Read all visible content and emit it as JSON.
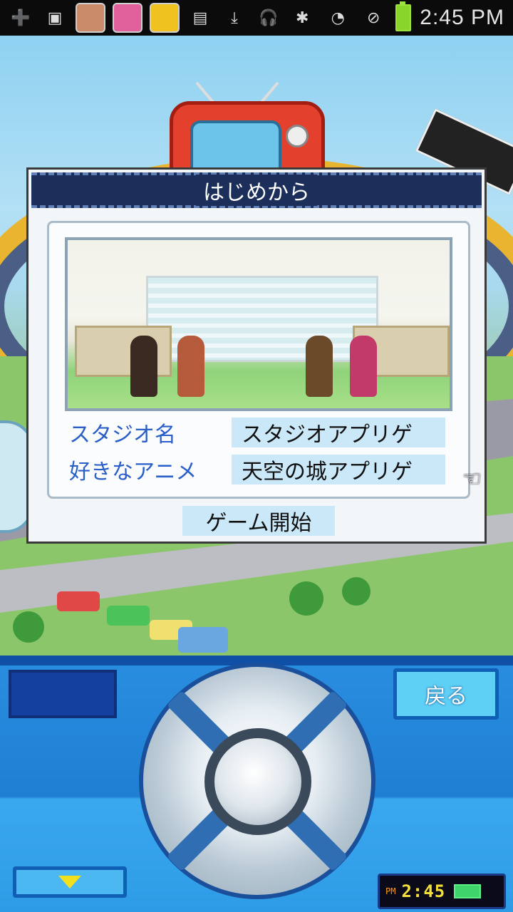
{
  "status_bar": {
    "time": "2:45 PM",
    "left_icons": [
      "plus-icon",
      "image-icon",
      "app-icon-1",
      "app-icon-2",
      "app-icon-3",
      "sd-card-icon",
      "download-icon",
      "headphones-icon"
    ],
    "right_icons": [
      "bluetooth-icon",
      "wifi-icon",
      "no-signal-icon",
      "battery-icon"
    ]
  },
  "dialog": {
    "title": "はじめから",
    "studio_label": "スタジオ名",
    "studio_value": "スタジオアプリゲ",
    "anime_label": "好きなアニメ",
    "anime_value": "天空の城アプリゲ",
    "start_label": "ゲーム開始"
  },
  "panel": {
    "back_label": "戻る",
    "clock_ampm": "PM",
    "clock_time": "2:45"
  },
  "colors": {
    "dialog_header": "#1b2f5a",
    "label_blue": "#2a5ec9",
    "field_bg": "#cbe8f9",
    "panel_blue": "#2a8ee0",
    "clock_yellow": "#f6df3b"
  }
}
